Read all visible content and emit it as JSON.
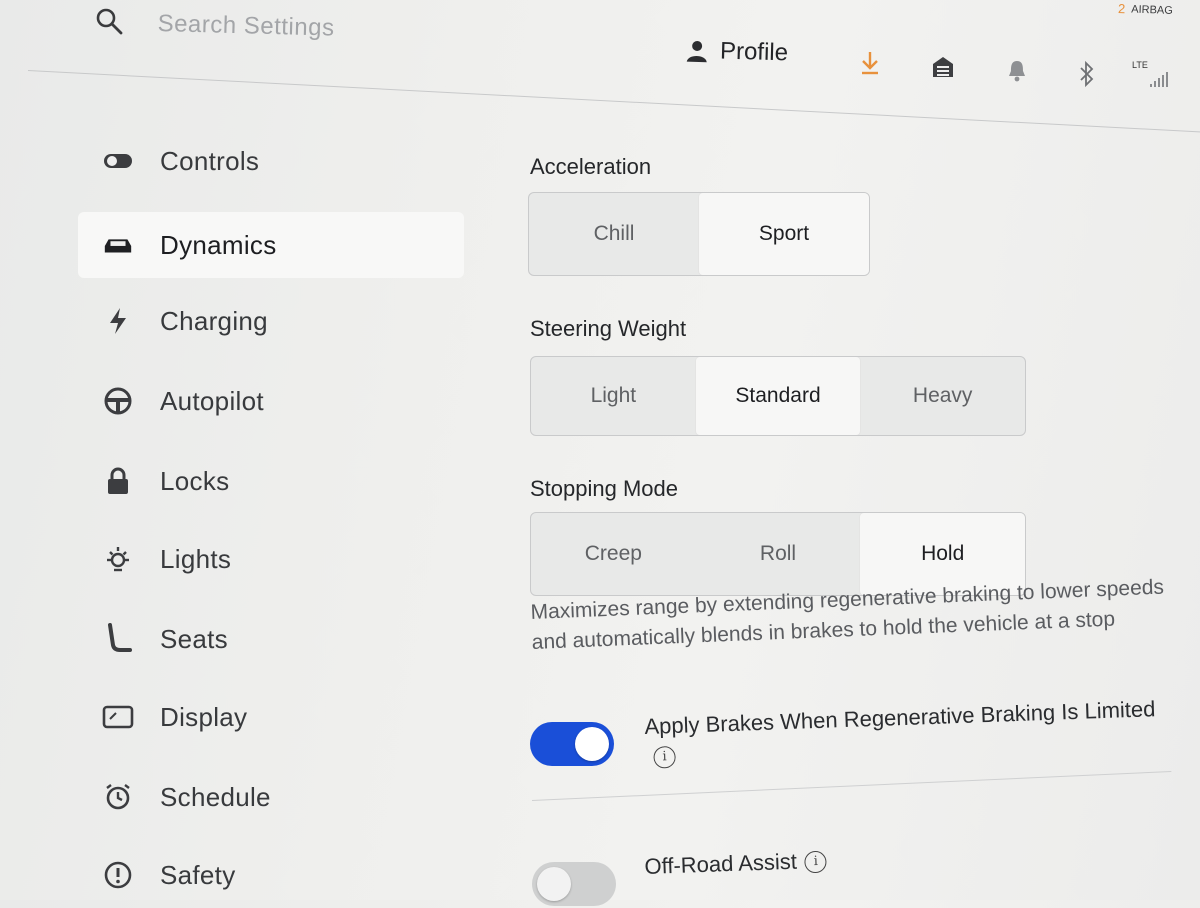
{
  "header": {
    "search_placeholder": "Search Settings",
    "profile_label": "Profile",
    "airbag_count": "2",
    "airbag_label": "AIRBAG",
    "lte_label": "LTE",
    "icons": [
      "search-icon",
      "person-icon",
      "download-icon",
      "garage-icon",
      "bell-icon",
      "bluetooth-icon",
      "signal-icon"
    ],
    "accent_download": "#e8913c"
  },
  "sidebar": {
    "items": [
      {
        "label": "Controls",
        "icon": "toggle-icon",
        "active": false
      },
      {
        "label": "Dynamics",
        "icon": "car-icon",
        "active": true
      },
      {
        "label": "Charging",
        "icon": "bolt-icon",
        "active": false
      },
      {
        "label": "Autopilot",
        "icon": "steering-wheel-icon",
        "active": false
      },
      {
        "label": "Locks",
        "icon": "lock-icon",
        "active": false
      },
      {
        "label": "Lights",
        "icon": "light-icon",
        "active": false
      },
      {
        "label": "Seats",
        "icon": "seat-icon",
        "active": false
      },
      {
        "label": "Display",
        "icon": "display-icon",
        "active": false
      },
      {
        "label": "Schedule",
        "icon": "alarm-clock-icon",
        "active": false
      },
      {
        "label": "Safety",
        "icon": "alert-circle-icon",
        "active": false
      }
    ]
  },
  "main": {
    "acceleration": {
      "title": "Acceleration",
      "options": [
        "Chill",
        "Sport"
      ],
      "selected": "Sport"
    },
    "steering_weight": {
      "title": "Steering Weight",
      "options": [
        "Light",
        "Standard",
        "Heavy"
      ],
      "selected": "Standard"
    },
    "stopping_mode": {
      "title": "Stopping Mode",
      "options": [
        "Creep",
        "Roll",
        "Hold"
      ],
      "selected": "Hold",
      "description": "Maximizes range by extending regenerative braking to lower speeds and automatically blends in brakes to hold the vehicle at a stop"
    },
    "apply_brakes": {
      "label": "Apply Brakes When Regenerative Braking Is Limited",
      "enabled": true
    },
    "off_road_assist": {
      "label": "Off-Road Assist",
      "enabled": false
    }
  },
  "colors": {
    "toggle_on": "#1a4fd8",
    "selected_segment": "#f7f7f6",
    "background": "#eeeeec"
  }
}
